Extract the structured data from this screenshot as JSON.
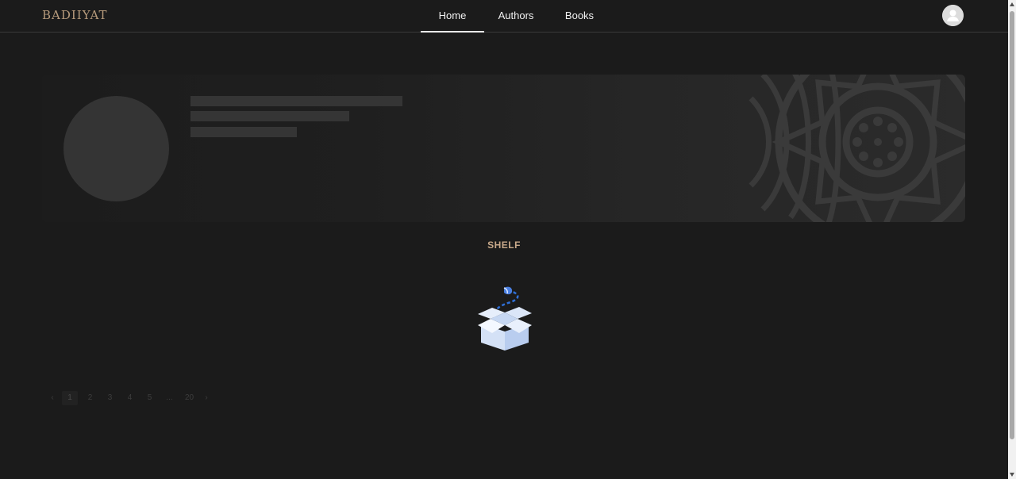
{
  "header": {
    "logo": "BADIIYAT",
    "nav": [
      {
        "label": "Home",
        "active": true
      },
      {
        "label": "Authors",
        "active": false
      },
      {
        "label": "Books",
        "active": false
      }
    ],
    "avatar_icon": "user-avatar-icon"
  },
  "banner": {
    "state": "loading",
    "decoration_icon": "mandala-ornament"
  },
  "shelf": {
    "title": "SHELF",
    "empty_icon": "empty-box-icon"
  },
  "pagination": {
    "prev_icon": "‹",
    "next_icon": "›",
    "pages": [
      "1",
      "2",
      "3",
      "4",
      "5"
    ],
    "ellipsis": "...",
    "last": "20",
    "current": "1"
  },
  "colors": {
    "background": "#1b1b1b",
    "accent": "#c8a98a",
    "logo": "#b79b7c"
  }
}
